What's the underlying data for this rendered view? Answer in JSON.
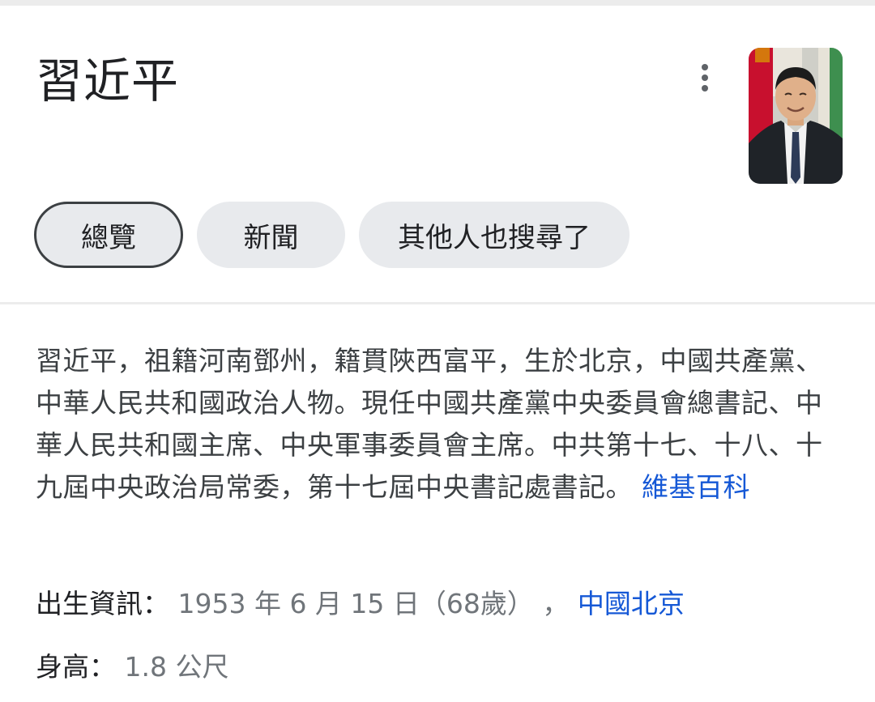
{
  "header": {
    "title": "習近平",
    "more_icon": "more-vert-icon",
    "avatar_alt": "portrait photo"
  },
  "tabs": [
    {
      "label": "總覽",
      "selected": true
    },
    {
      "label": "新聞",
      "selected": false
    },
    {
      "label": "其他人也搜尋了",
      "selected": false
    }
  ],
  "description": {
    "text": "習近平，祖籍河南鄧州，籍貫陜西富平，生於北京，中國共產黨、中華人民共和國政治人物。現任中國共產黨中央委員會總書記、中華人民共和國主席、中央軍事委員會主席。中共第十七、十八、十九屆中央政治局常委，第十七屆中央書記處書記。",
    "source_link": "維基百科"
  },
  "facts": {
    "birth": {
      "label": "出生資訊：",
      "value": "1953 年 6 月 15 日（68歲）",
      "separator": "，",
      "place_link": "中國北京"
    },
    "height": {
      "label": "身高：",
      "value": "1.8 公尺"
    }
  },
  "colors": {
    "link": "#1558d6",
    "chip_bg": "#e8eaed",
    "text_primary": "#202124",
    "text_secondary": "#70757a"
  }
}
